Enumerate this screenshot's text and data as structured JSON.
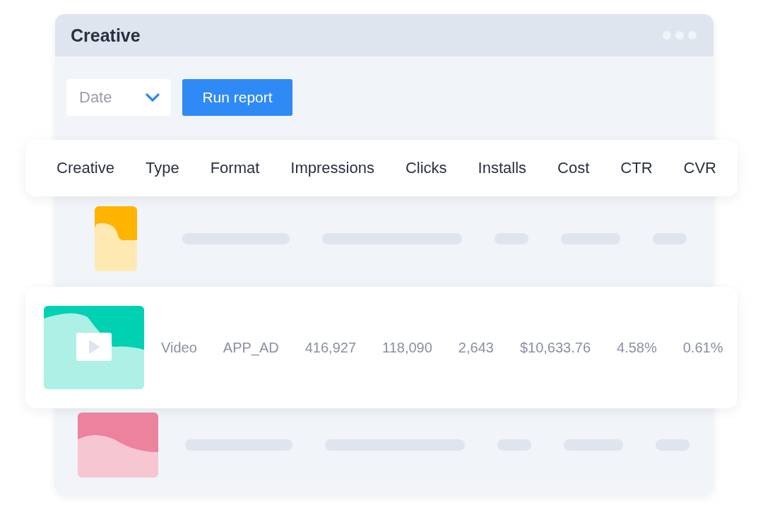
{
  "window": {
    "title": "Creative"
  },
  "toolbar": {
    "dropdown": {
      "placeholder": "Date"
    },
    "button": "Run report"
  },
  "table": {
    "columns": [
      "Creative",
      "Type",
      "Format",
      "Impressions",
      "Clicks",
      "Installs",
      "Cost",
      "CTR",
      "CVR"
    ],
    "rows": [
      {
        "kind": "portrait",
        "color": "#ffb400"
      },
      {
        "kind": "video",
        "color": "#00d1b2",
        "cells": [
          "Video",
          "APP_AD",
          "416,927",
          "118,090",
          "2,643",
          "$10,633.76",
          "4.58%",
          "0.61%"
        ]
      },
      {
        "kind": "landscape",
        "color": "#ec829e"
      }
    ]
  }
}
